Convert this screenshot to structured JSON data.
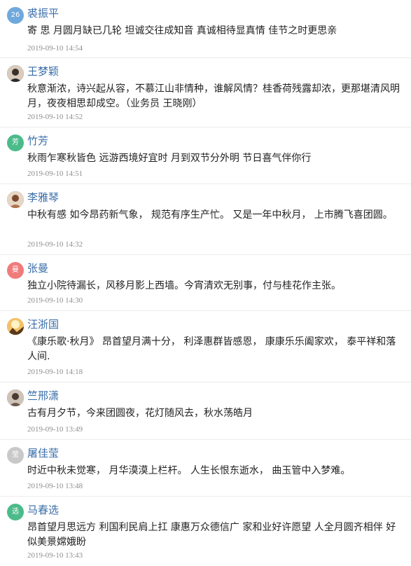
{
  "comments": [
    {
      "avatar_text": "26",
      "avatar_color": "#6fa8dc",
      "avatar_kind": "badge",
      "name": "裘振平",
      "content": "寄 思 月圆月缺已几轮 坦诚交往成知音 真诚相待显真情 佳节之时更思亲",
      "time": "2019-09-10 14:54"
    },
    {
      "avatar_text": "",
      "avatar_color": "#4a4a4a",
      "avatar_kind": "photo",
      "name": "王梦颖",
      "content": "秋意渐浓，诗兴起从容，不慕江山非情种，谁解风情？桂香荷残露却浓，更那堪清风明月，夜夜相思却成空。（业务员 王晓刚）",
      "time": "2019-09-10 14:52"
    },
    {
      "avatar_text": "芳",
      "avatar_color": "#4cbb8a",
      "avatar_kind": "badge",
      "name": "竹芳",
      "content": "秋雨乍寒秋皆色 远游西境好宜时 月到双节分外明 节日喜气伴你行",
      "time": "2019-09-10 14:51"
    },
    {
      "avatar_text": "",
      "avatar_color": "#a0522d",
      "avatar_kind": "photo",
      "name": "李雅琴",
      "content": "中秋有感 如今昂药新气象， 规范有序生产忙。 又是一年中秋月， 上市腾飞喜团圆。",
      "time": "2019-09-10 14:32"
    },
    {
      "avatar_text": "曼",
      "avatar_color": "#f07b7b",
      "avatar_kind": "badge",
      "name": "张曼",
      "content": "独立小院待漏长，风移月影上西墙。今宵清欢无别事，付与桂花作主张。",
      "time": "2019-09-10 14:30"
    },
    {
      "avatar_text": "",
      "avatar_color": "#c8872a",
      "avatar_kind": "photo",
      "name": "汪浙国",
      "content": "《康乐歌·秋月》 昂首望月满十分， 利泽惠群皆感恩， 康康乐乐阖家欢， 泰平祥和落人间.",
      "time": "2019-09-10 14:18"
    },
    {
      "avatar_text": "",
      "avatar_color": "#6b5a4e",
      "avatar_kind": "photo",
      "name": "竺邢潇",
      "content": "古有月夕节，今来团圆夜，花灯随风去，秋水荡皓月",
      "time": "2019-09-10 13:49"
    },
    {
      "avatar_text": "莹",
      "avatar_color": "#c9c9c9",
      "avatar_kind": "badge",
      "name": "屠佳莹",
      "content": "时近中秋未觉寒， 月华漠漠上栏杆。 人生长恨东逝水， 曲玉管中入梦难。",
      "time": "2019-09-10 13:48"
    },
    {
      "avatar_text": "选",
      "avatar_color": "#4cbb8a",
      "avatar_kind": "badge",
      "name": "马春选",
      "content": "昂首望月思远方 利国利民肩上扛 康惠万众德信广 家和业好许愿望 人全月圆齐相伴 好似美景嫦娥盼",
      "time": "2019-09-10 13:43"
    }
  ]
}
